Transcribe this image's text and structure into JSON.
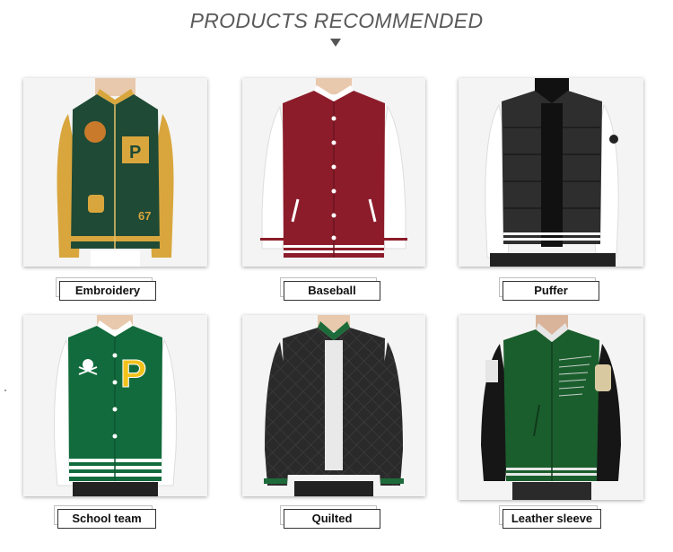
{
  "header": {
    "title": "PRODUCTS RECOMMENDED",
    "arrow_icon": "triangle-down-icon"
  },
  "products": [
    {
      "label": "Embroidery",
      "colors": {
        "body": "#1f4a36",
        "sleeve": "#d9a63d"
      }
    },
    {
      "label": "Baseball",
      "colors": {
        "body": "#8c1c2a",
        "sleeve": "#ffffff"
      }
    },
    {
      "label": "Puffer",
      "colors": {
        "body": "#2e2e2e",
        "sleeve": "#ffffff"
      }
    },
    {
      "label": "School team",
      "colors": {
        "body": "#126b3c",
        "sleeve": "#ffffff",
        "patch": "#f2c21b"
      }
    },
    {
      "label": "Quilted",
      "colors": {
        "body": "#2a2a2a",
        "sleeve": "#2a2a2a",
        "trim": "#1d6b3a"
      }
    },
    {
      "label": "Leather sleeve",
      "colors": {
        "body": "#1b5e2d",
        "sleeve": "#161616"
      }
    }
  ]
}
